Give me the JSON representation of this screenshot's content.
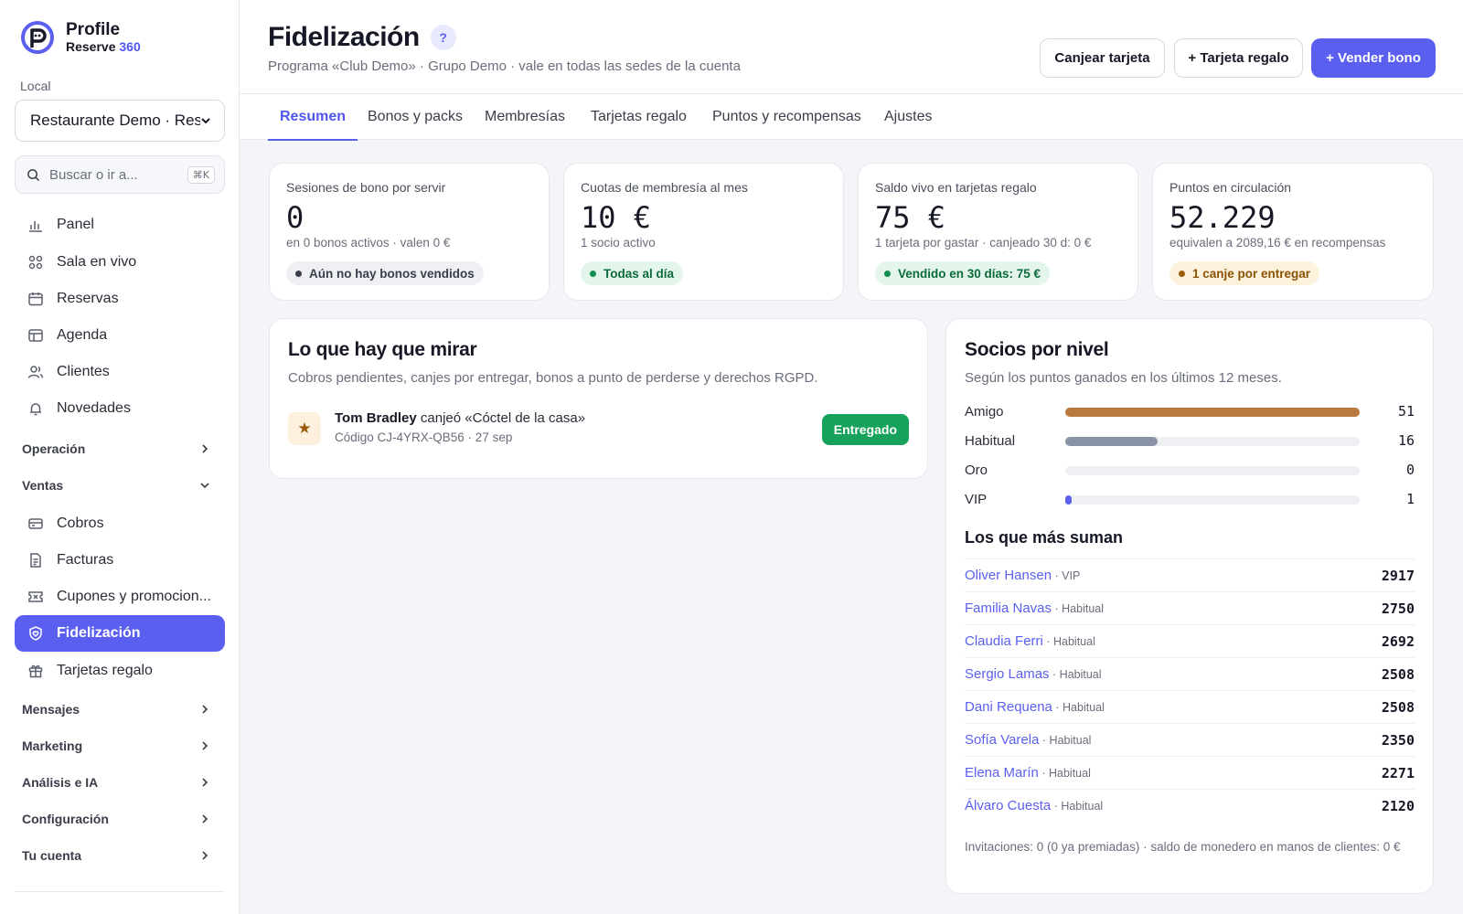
{
  "brand": {
    "name": "Profile",
    "product": "Reserve",
    "product_accent": "360"
  },
  "sidebar": {
    "local_label": "Local",
    "local_value": "Restaurante Demo · Res",
    "search_placeholder": "Buscar o ir a...",
    "search_shortcut": "⌘K",
    "items_top": [
      {
        "label": "Panel",
        "icon": "chart-bar-icon"
      },
      {
        "label": "Sala en vivo",
        "icon": "grid-icon"
      },
      {
        "label": "Reservas",
        "icon": "calendar-icon"
      },
      {
        "label": "Agenda",
        "icon": "table-icon"
      },
      {
        "label": "Clientes",
        "icon": "users-icon"
      },
      {
        "label": "Novedades",
        "icon": "bell-icon"
      }
    ],
    "section_operacion": "Operación",
    "section_ventas": "Ventas",
    "items_ventas": [
      {
        "label": "Cobros",
        "icon": "card-icon"
      },
      {
        "label": "Facturas",
        "icon": "document-icon"
      },
      {
        "label": "Cupones y promocion...",
        "icon": "ticket-icon"
      },
      {
        "label": "Fidelización",
        "icon": "heart-shield-icon",
        "active": true
      },
      {
        "label": "Tarjetas regalo",
        "icon": "gift-icon"
      }
    ],
    "sections_bottom": [
      "Mensajes",
      "Marketing",
      "Análisis e IA",
      "Configuración",
      "Tu cuenta"
    ]
  },
  "header": {
    "title": "Fidelización",
    "help": "?",
    "subtitle": "Programa «Club Demo» · Grupo Demo · vale en todas las sedes de la cuenta",
    "btn_redeem": "Canjear tarjeta",
    "btn_gift": "+ Tarjeta regalo",
    "btn_sell": "+ Vender bono"
  },
  "tabs": [
    "Resumen",
    "Bonos y packs",
    "Membresías",
    "Tarjetas regalo",
    "Puntos y recompensas",
    "Ajustes"
  ],
  "kpis": [
    {
      "label": "Sesiones de bono por servir",
      "value": "0",
      "sub": "en 0 bonos activos · valen 0 €",
      "badge": "Aún no hay bonos vendidos",
      "tone": "gray"
    },
    {
      "label": "Cuotas de membresía al mes",
      "value": "10 €",
      "sub": "1 socio activo",
      "badge": "Todas al día",
      "tone": "green"
    },
    {
      "label": "Saldo vivo en tarjetas regalo",
      "value": "75 €",
      "sub": "1 tarjeta por gastar · canjeado 30 d: 0 €",
      "badge": "Vendido en 30 días: 75 €",
      "tone": "green"
    },
    {
      "label": "Puntos en circulación",
      "value": "52.229",
      "sub": "equivalen a 2089,16 € en recompensas",
      "badge": "1 canje por entregar",
      "tone": "amber"
    }
  ],
  "watch": {
    "title": "Lo que hay que mirar",
    "subtitle": "Cobros pendientes, canjes por entregar, bonos a punto de perderse y derechos RGPD.",
    "item_name": "Tom Bradley",
    "item_action": " canjeó «Cóctel de la casa»",
    "item_sub": "Código CJ-4YRX-QB56 · 27 sep",
    "item_button": "Entregado"
  },
  "tiers": {
    "title": "Socios por nivel",
    "subtitle": "Según los puntos ganados en los últimos 12 meses.",
    "rows": [
      {
        "name": "Amigo",
        "count": 51,
        "color": "#b87a3f"
      },
      {
        "name": "Habitual",
        "count": 16,
        "color": "#8a92a6"
      },
      {
        "name": "Oro",
        "count": 0,
        "color": "#d4a62a"
      },
      {
        "name": "VIP",
        "count": 1,
        "color": "#5b5ff0"
      }
    ],
    "max": 51
  },
  "top": {
    "title": "Los que más suman",
    "rows": [
      {
        "name": "Oliver Hansen",
        "level": " · VIP",
        "points": "2917"
      },
      {
        "name": "Familia Navas",
        "level": " · Habitual",
        "points": "2750"
      },
      {
        "name": "Claudia Ferri",
        "level": " · Habitual",
        "points": "2692"
      },
      {
        "name": "Sergio Lamas",
        "level": " · Habitual",
        "points": "2508"
      },
      {
        "name": "Dani Requena",
        "level": " · Habitual",
        "points": "2508"
      },
      {
        "name": "Sofía Varela",
        "level": " · Habitual",
        "points": "2350"
      },
      {
        "name": "Elena Marín",
        "level": " · Habitual",
        "points": "2271"
      },
      {
        "name": "Álvaro Cuesta",
        "level": " · Habitual",
        "points": "2120"
      }
    ],
    "footnote": "Invitaciones: 0 (0 ya premiadas) · saldo de monedero en manos de clientes: 0 €"
  }
}
